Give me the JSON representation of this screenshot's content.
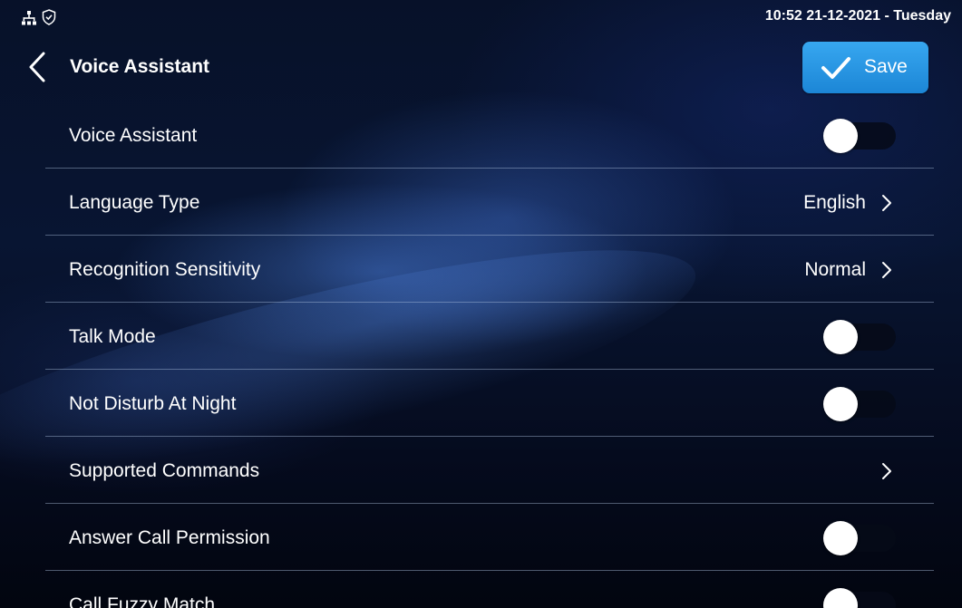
{
  "status_bar": {
    "network_icon": "network-tree-icon",
    "security_icon": "shield-check-icon",
    "datetime": "10:52  21-12-2021 - Tuesday"
  },
  "header": {
    "back_icon": "chevron-left-icon",
    "title": "Voice Assistant",
    "save_button": {
      "label": "Save",
      "icon": "checkmark-icon",
      "color": "#2a97e4"
    }
  },
  "settings": [
    {
      "label": "Voice Assistant",
      "type": "toggle",
      "enabled": false
    },
    {
      "label": "Language Type",
      "type": "select",
      "value": "English"
    },
    {
      "label": "Recognition Sensitivity",
      "type": "select",
      "value": "Normal"
    },
    {
      "label": "Talk Mode",
      "type": "toggle",
      "enabled": false
    },
    {
      "label": "Not Disturb At Night",
      "type": "toggle",
      "enabled": false
    },
    {
      "label": "Supported Commands",
      "type": "link",
      "value": ""
    },
    {
      "label": "Answer Call Permission",
      "type": "toggle",
      "enabled": false
    },
    {
      "label": "Call Fuzzy Match",
      "type": "toggle",
      "enabled": false
    }
  ]
}
